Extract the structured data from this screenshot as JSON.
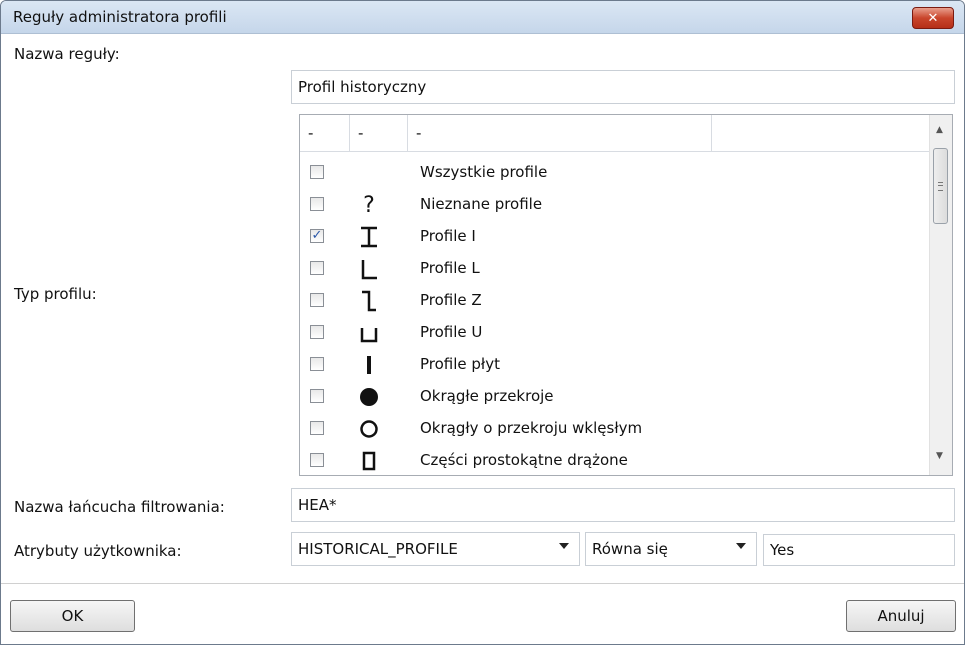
{
  "window": {
    "title": "Reguły administratora profili",
    "close_label": "✕"
  },
  "rule_name": {
    "label": "Nazwa reguły:",
    "value": "Profil historyczny"
  },
  "profile_type": {
    "label": "Typ profilu:",
    "columns": [
      "-",
      "-",
      "-",
      ""
    ],
    "items": [
      {
        "checked": false,
        "symbol": "",
        "label": "Wszystkie profile"
      },
      {
        "checked": false,
        "symbol": "question-icon",
        "label": "Nieznane profile"
      },
      {
        "checked": true,
        "symbol": "i-profile-icon",
        "label": "Profile I"
      },
      {
        "checked": false,
        "symbol": "l-profile-icon",
        "label": "Profile L"
      },
      {
        "checked": false,
        "symbol": "z-profile-icon",
        "label": "Profile Z"
      },
      {
        "checked": false,
        "symbol": "u-profile-icon",
        "label": "Profile U"
      },
      {
        "checked": false,
        "symbol": "plate-profile-icon",
        "label": "Profile płyt"
      },
      {
        "checked": false,
        "symbol": "round-solid-icon",
        "label": "Okrągłe przekroje"
      },
      {
        "checked": false,
        "symbol": "round-hollow-icon",
        "label": "Okrągły o przekroju wklęsłym"
      },
      {
        "checked": false,
        "symbol": "rect-hollow-icon",
        "label": "Części prostokątne drążone"
      }
    ],
    "check_mark": "✓"
  },
  "filter_chain": {
    "label": "Nazwa łańcucha filtrowania:",
    "value": "HEA*"
  },
  "user_attributes": {
    "label": "Atrybuty użytkownika:",
    "attribute": "HISTORICAL_PROFILE",
    "operator": "Równa się",
    "value": "Yes"
  },
  "buttons": {
    "ok": "OK",
    "cancel": "Anuluj"
  },
  "colors": {
    "titlebar": "#c5d6ea",
    "close": "#c9452c",
    "check": "#2a57a8"
  }
}
